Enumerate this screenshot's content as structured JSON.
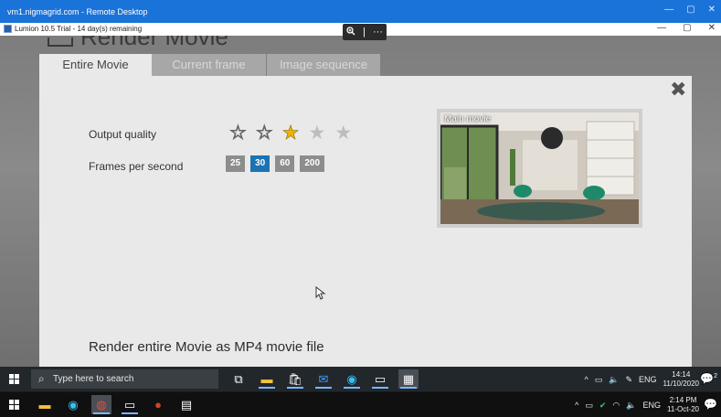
{
  "remote_window": {
    "title": "vm1.nigmagrid.com - Remote Desktop",
    "controls": [
      "—",
      "▢",
      "✕"
    ]
  },
  "app_window": {
    "title": "Lumion 10.5 Trial - 14 day(s) remaining",
    "controls": [
      "—",
      "▢",
      "✕"
    ]
  },
  "zoom_toolbar": {
    "zoom_icon": "zoom-icon",
    "separator": "|",
    "more": "···"
  },
  "render": {
    "heading": "Render Movie",
    "tabs": [
      {
        "label": "Entire Movie",
        "active": true
      },
      {
        "label": "Current frame",
        "active": false
      },
      {
        "label": "Image sequence",
        "active": false
      }
    ],
    "close_icon": "close-icon",
    "output_quality": {
      "label": "Output quality",
      "rating": 3,
      "max": 5
    },
    "fps": {
      "label": "Frames per second",
      "options": [
        "25",
        "30",
        "60",
        "200"
      ],
      "selected": "30"
    },
    "preview": {
      "label": "Main movie"
    },
    "bottom_text": "Render entire Movie as MP4 movie file"
  },
  "remote_taskbar": {
    "search_placeholder": "Type here to search",
    "tray": {
      "language": "ENG",
      "time": "14:14",
      "date": "11/10/2020",
      "notifications": "2"
    }
  },
  "local_taskbar": {
    "tray": {
      "language": "ENG",
      "time": "2:14 PM",
      "date": "11-Oct-20"
    }
  },
  "colors": {
    "accent": "#1b73b3",
    "star": "#f2b200",
    "titlebar": "#1a73d8"
  }
}
